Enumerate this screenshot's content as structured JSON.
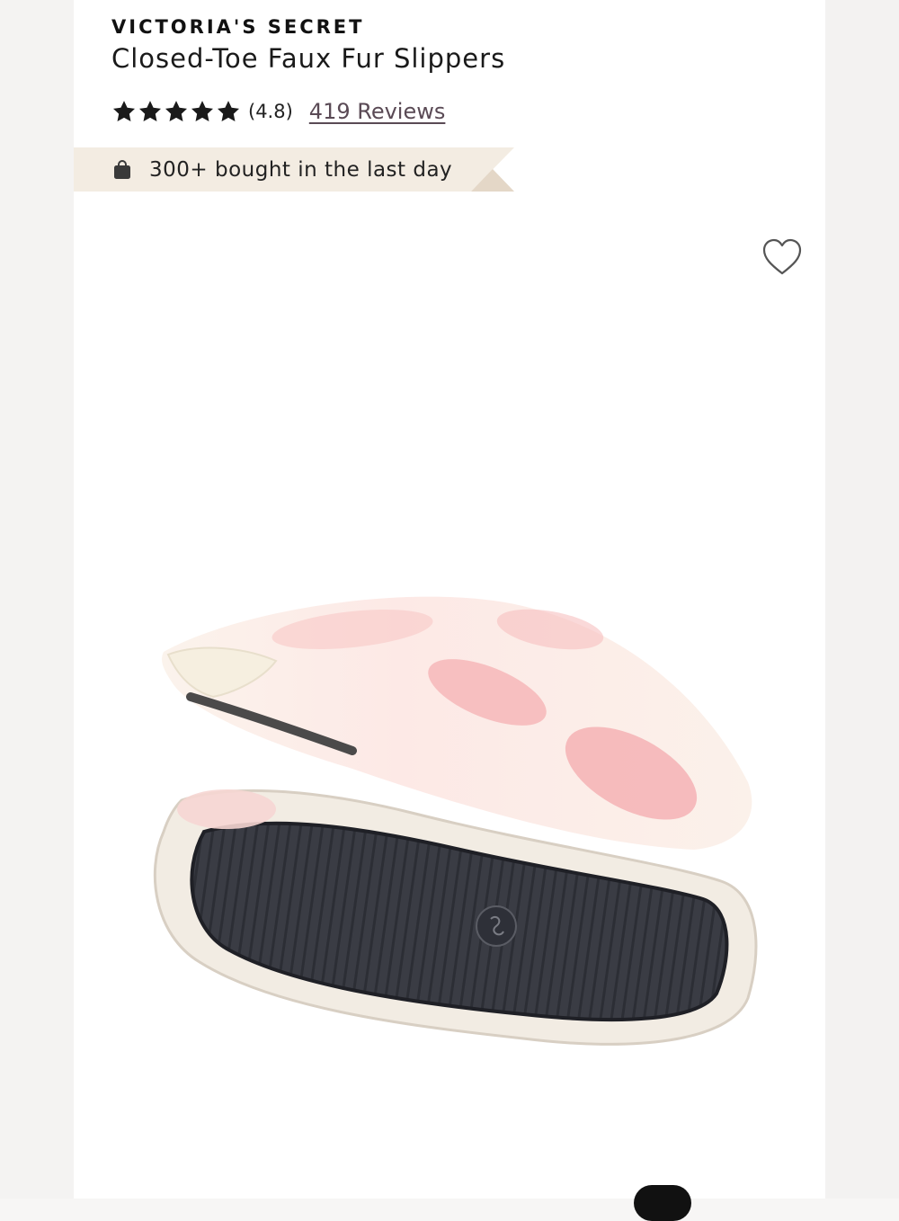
{
  "product": {
    "brand": "VICTORIA'S SECRET",
    "title": "Closed-Toe Faux Fur Slippers",
    "rating": {
      "stars": 5,
      "value_label": "(4.8)",
      "reviews_label": "419 Reviews"
    },
    "social_proof": {
      "icon": "shopping-bag-icon",
      "text": "300+ bought in the last day"
    }
  },
  "colors": {
    "banner_bg": "#f3ece2",
    "banner_fold": "#e4d7c7",
    "text_primary": "#111111",
    "link": "#5a4a55"
  },
  "icons": {
    "favorite": "heart-outline-icon",
    "star": "star-icon"
  }
}
